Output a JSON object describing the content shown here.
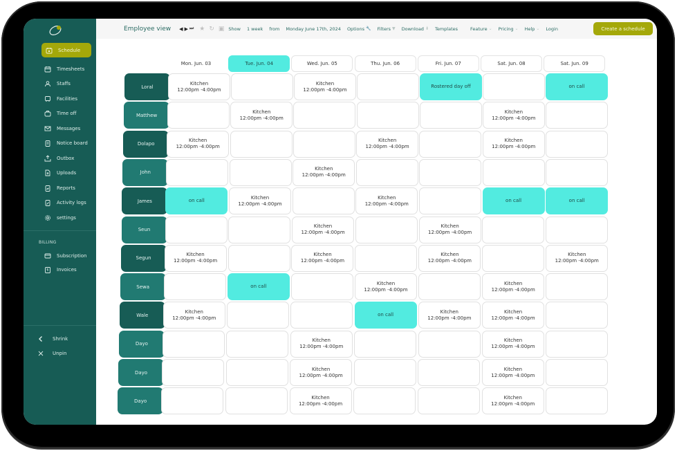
{
  "colors": {
    "sidebar": "#175c55",
    "accent": "#a4a80a",
    "highlight": "#52ebe0",
    "name_dark": "#175c55",
    "name_light": "#217a72"
  },
  "sidebar": {
    "logo": "app-logo",
    "items": [
      {
        "label": "Schedule",
        "icon": "calendar-icon",
        "active": true
      },
      {
        "label": "Timesheets",
        "icon": "calendar-grid-icon"
      },
      {
        "label": "Staffs",
        "icon": "users-icon"
      },
      {
        "label": "Facilities",
        "icon": "building-icon"
      },
      {
        "label": "Time off",
        "icon": "briefcase-icon"
      },
      {
        "label": "Messages",
        "icon": "mail-icon"
      },
      {
        "label": "Notice board",
        "icon": "clipboard-icon"
      },
      {
        "label": "Outbox",
        "icon": "outbox-icon"
      },
      {
        "label": "Uploads",
        "icon": "upload-file-icon"
      },
      {
        "label": "Reports",
        "icon": "report-icon"
      },
      {
        "label": "Activity logs",
        "icon": "activity-log-icon"
      },
      {
        "label": "settings",
        "icon": "gear-icon"
      }
    ],
    "billing_label": "BILLING",
    "billing_items": [
      {
        "label": "Subscription",
        "icon": "credit-card-icon"
      },
      {
        "label": "Invoices",
        "icon": "invoice-icon"
      }
    ],
    "bottom_items": [
      {
        "label": "Shrink",
        "icon": "chevron-left-icon"
      },
      {
        "label": "Unpin",
        "icon": "close-icon"
      }
    ]
  },
  "topbar": {
    "title": "Employee view",
    "show_label": "Show",
    "range": "1 week",
    "from_label": "from",
    "date": "Monday June 17th, 2024",
    "options": "Options",
    "filters": "Filters",
    "download": "Download",
    "templates": "Templates",
    "feature": "Feature",
    "pricing": "Pricing",
    "help": "Help",
    "login": "Login",
    "cta": "Create a schedule"
  },
  "schedule": {
    "days": [
      "Mon. Jun. 03",
      "Tue. Jun. 04",
      "Wed. Jun. 05",
      "Thu. Jun. 06",
      "Fri. Jun. 07",
      "Sat. Jun. 08",
      "Sat. Jun. 09"
    ],
    "today_index": 1,
    "shift_title": "Kitchen",
    "shift_time": "12:00pm -4:00pm",
    "rows": [
      {
        "name": "Loral",
        "dark": true,
        "cells": [
          "K",
          "",
          "K",
          "",
          "Rostered day off",
          "",
          "on call"
        ]
      },
      {
        "name": "Matthew",
        "dark": false,
        "cells": [
          "",
          "K",
          "",
          "",
          "",
          "K",
          ""
        ]
      },
      {
        "name": "Dolapo",
        "dark": true,
        "cells": [
          "K",
          "",
          "",
          "K",
          "",
          "K",
          ""
        ]
      },
      {
        "name": "John",
        "dark": false,
        "cells": [
          "",
          "",
          "K",
          "",
          "",
          "",
          ""
        ]
      },
      {
        "name": "James",
        "dark": true,
        "cells": [
          "on call",
          "K",
          "",
          "K",
          "",
          "on call",
          "on call"
        ]
      },
      {
        "name": "Seun",
        "dark": false,
        "cells": [
          "",
          "",
          "K",
          "",
          "K",
          "",
          ""
        ]
      },
      {
        "name": "Segun",
        "dark": true,
        "cells": [
          "K",
          "",
          "K",
          "",
          "K",
          "",
          "K"
        ]
      },
      {
        "name": "Sewa",
        "dark": false,
        "cells": [
          "",
          "on call",
          "",
          "K",
          "",
          "K",
          ""
        ]
      },
      {
        "name": "Wale",
        "dark": true,
        "cells": [
          "K",
          "",
          "",
          "on call",
          "K",
          "K",
          ""
        ]
      },
      {
        "name": "Dayo",
        "dark": false,
        "cells": [
          "",
          "",
          "K",
          "",
          "",
          "K",
          ""
        ]
      },
      {
        "name": "Dayo",
        "dark": false,
        "cells": [
          "",
          "",
          "K",
          "",
          "",
          "K",
          ""
        ]
      },
      {
        "name": "Dayo",
        "dark": false,
        "cells": [
          "",
          "",
          "K",
          "",
          "",
          "K",
          ""
        ]
      }
    ]
  }
}
